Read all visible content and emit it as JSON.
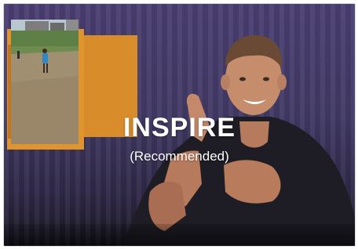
{
  "option": {
    "title": "INSPIRE",
    "subtitle": "(Recommended)"
  },
  "colors": {
    "background_purple": "#463c6b",
    "accent_orange": "#e0942e",
    "text": "#ffffff"
  }
}
